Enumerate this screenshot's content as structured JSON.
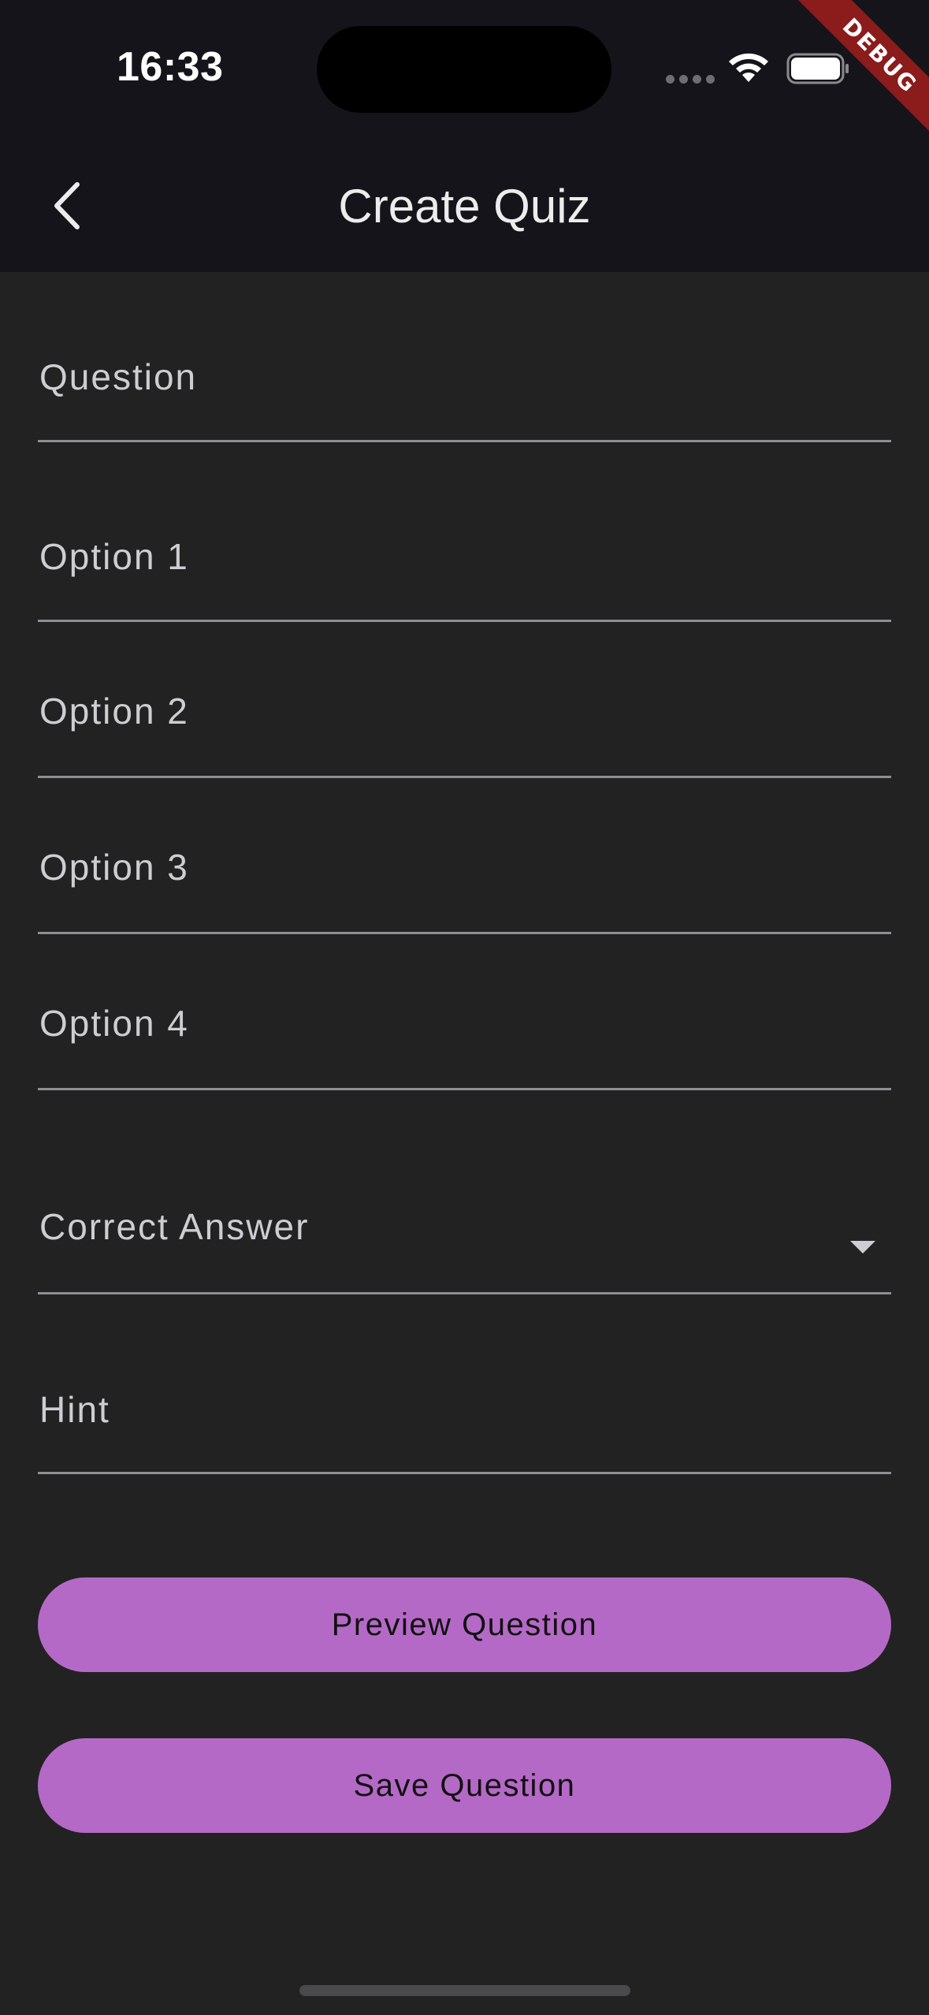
{
  "status_bar": {
    "time": "16:33"
  },
  "debug_banner": {
    "label": "DEBUG",
    "color": "#8c1b1b"
  },
  "app_bar": {
    "title": "Create Quiz",
    "back_icon": "chevron-left-icon",
    "background": "#15141a"
  },
  "form": {
    "question": {
      "label": "Question"
    },
    "options": [
      {
        "label": "Option 1"
      },
      {
        "label": "Option 2"
      },
      {
        "label": "Option 3"
      },
      {
        "label": "Option 4"
      }
    ],
    "correct_answer": {
      "label": "Correct Answer",
      "icon": "dropdown-arrow-icon"
    },
    "hint": {
      "label": "Hint"
    }
  },
  "actions": {
    "preview_label": "Preview Question",
    "save_label": "Save Question",
    "accent": "#b569c6"
  },
  "theme": {
    "background": "#222222",
    "label_color": "#cdcdd2",
    "underline_color": "#8e8e93"
  }
}
